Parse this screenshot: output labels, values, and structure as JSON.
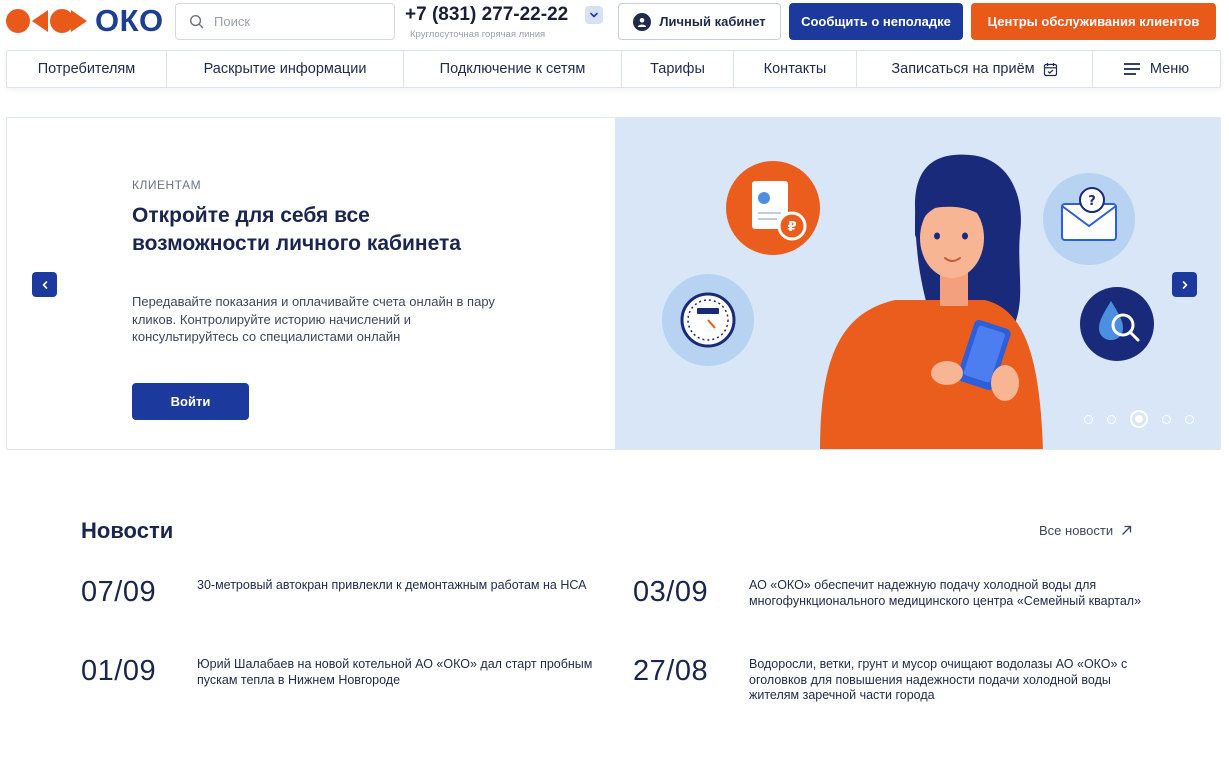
{
  "header": {
    "logo_text": "ОКО",
    "search_placeholder": "Поиск",
    "phone": "+7 (831) 277-22-22",
    "phone_caption": "Круглосуточная горячая линия",
    "cabinet_label": "Личный кабинет",
    "report_label": "Сообщить о неполадке",
    "centers_label": "Центры обслуживания клиентов",
    "colors": {
      "brand_blue": "#1c3a9e",
      "brand_orange": "#e8591a"
    }
  },
  "nav": {
    "items": [
      {
        "label": "Потребителям"
      },
      {
        "label": "Раскрытие информации"
      },
      {
        "label": "Подключение к сетям"
      },
      {
        "label": "Тарифы"
      },
      {
        "label": "Контакты"
      },
      {
        "label": "Записаться на приём",
        "icon": "calendar-icon"
      },
      {
        "label": "Меню",
        "icon": "hamburger-icon"
      }
    ]
  },
  "hero": {
    "kicker": "КЛИЕНТАМ",
    "title": "Откройте для себя все возможности личного кабинета",
    "description": "Передавайте показания и оплачивайте счета онлайн в пару кликов. Контролируйте историю начислений и консультируйтесь со специалистами онлайн",
    "button_label": "Войти",
    "slides_total": 5,
    "active_slide": 3
  },
  "news": {
    "title": "Новости",
    "all_label": "Все новости",
    "items": [
      {
        "date": "07/09",
        "text": "30-метровый автокран привлекли к демонтажным работам на НСА"
      },
      {
        "date": "03/09",
        "text": "АО «ОКО» обеспечит надежную подачу холодной воды для многофункционального медицинского центра «Семейный квартал»"
      },
      {
        "date": "01/09",
        "text": "Юрий Шалабаев на новой котельной АО «ОКО» дал старт пробным пускам тепла в Нижнем Новгороде"
      },
      {
        "date": "27/08",
        "text": "Водоросли, ветки, грунт и мусор очищают водолазы АО «ОКО» с оголовков для повышения надежности подачи холодной воды жителям заречной части города"
      }
    ]
  }
}
